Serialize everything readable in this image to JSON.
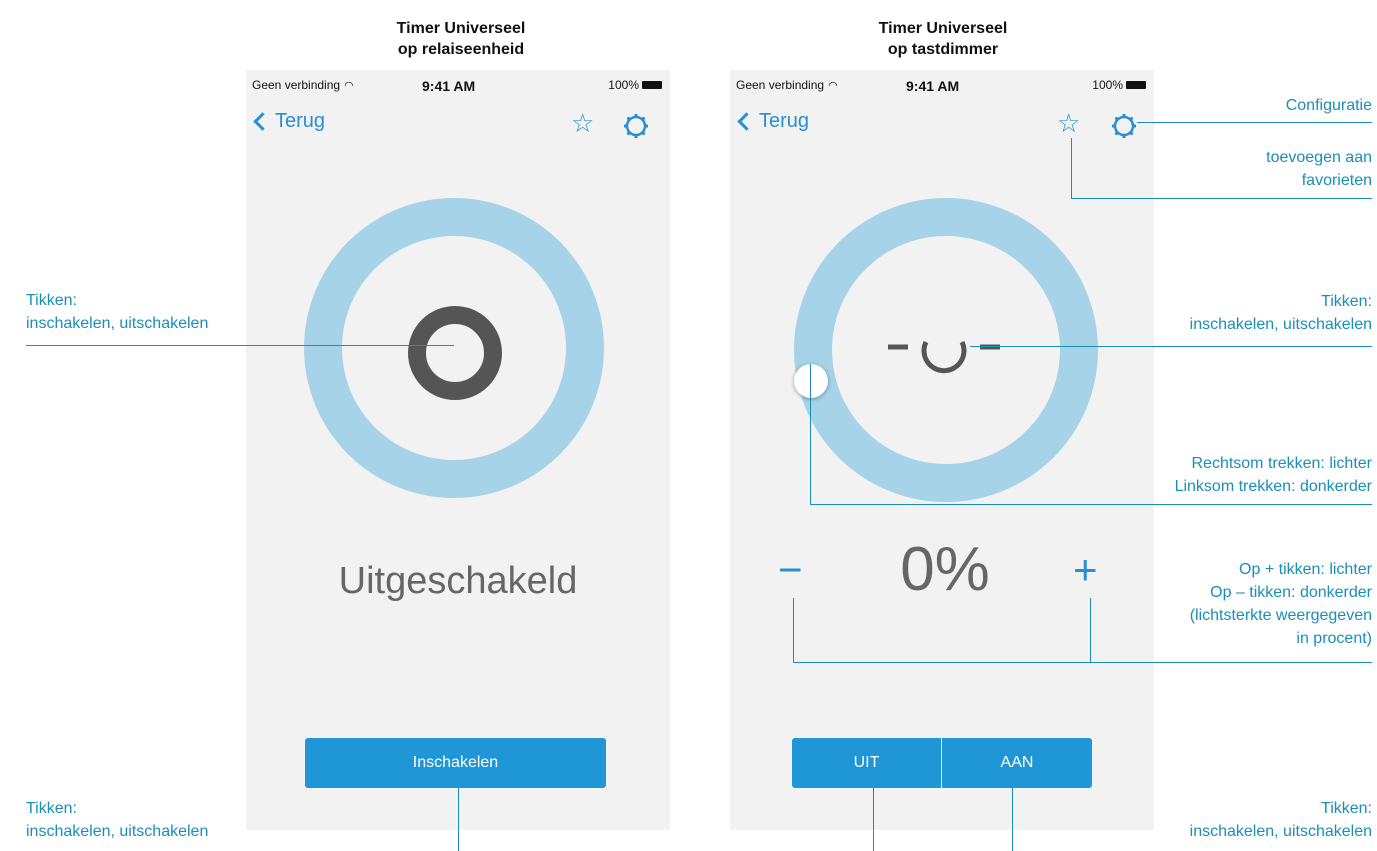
{
  "left": {
    "title_line1": "Timer Universeel",
    "title_line2": "op relaiseenheid",
    "status": {
      "carrier": "Geen verbinding",
      "time": "9:41 AM",
      "battery": "100%"
    },
    "back_label": "Terug",
    "state_text": "Uitgeschakeld",
    "button_label": "Inschakelen"
  },
  "right": {
    "title_line1": "Timer Universeel",
    "title_line2": "op tastdimmer",
    "status": {
      "carrier": "Geen verbinding",
      "time": "9:41 AM",
      "battery": "100%"
    },
    "back_label": "Terug",
    "percent": "0%",
    "minus_label": "−",
    "plus_label": "+",
    "off_label": "UIT",
    "on_label": "AAN"
  },
  "annotations": {
    "left_ring": {
      "line1": "Tikken:",
      "line2": "inschakelen, uitschakelen"
    },
    "left_button": {
      "line1": "Tikken:",
      "line2": "inschakelen, uitschakelen"
    },
    "config": "Configuratie",
    "favorites": {
      "line1": "toevoegen aan",
      "line2": "favorieten"
    },
    "right_ring": {
      "line1": "Tikken:",
      "line2": "inschakelen, uitschakelen"
    },
    "drag": {
      "line1": "Rechtsom trekken: lichter",
      "line2": "Linksom trekken: donkerder"
    },
    "plusminus": {
      "line1": "Op + tikken: lichter",
      "line2": "Op – tikken: donkerder",
      "line3": "(lichtsterkte weergegeven",
      "line4": "in procent)"
    },
    "right_buttons": {
      "line1": "Tikken:",
      "line2": "inschakelen, uitschakelen"
    }
  },
  "colors": {
    "accent": "#1f96d6",
    "ring": "#a7d3e8",
    "annotation": "#1a8fb5",
    "icon_dark": "#555555"
  }
}
